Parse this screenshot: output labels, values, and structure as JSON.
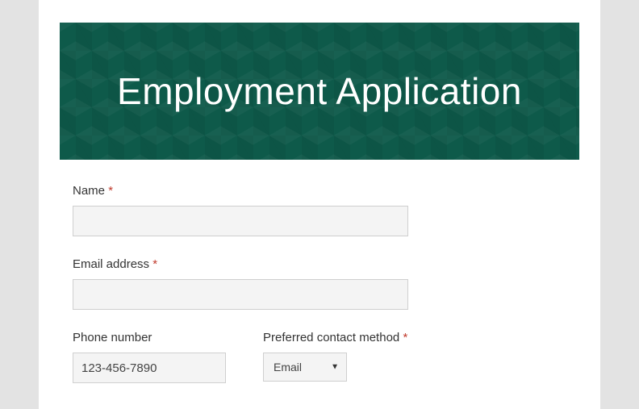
{
  "banner": {
    "title": "Employment Application"
  },
  "required_marker": "*",
  "fields": {
    "name": {
      "label": "Name",
      "required": true,
      "value": ""
    },
    "email": {
      "label": "Email address",
      "required": true,
      "value": ""
    },
    "phone": {
      "label": "Phone number",
      "required": false,
      "value": "123-456-7890"
    },
    "contact_method": {
      "label": "Preferred contact method",
      "required": true,
      "selected": "Email"
    }
  }
}
